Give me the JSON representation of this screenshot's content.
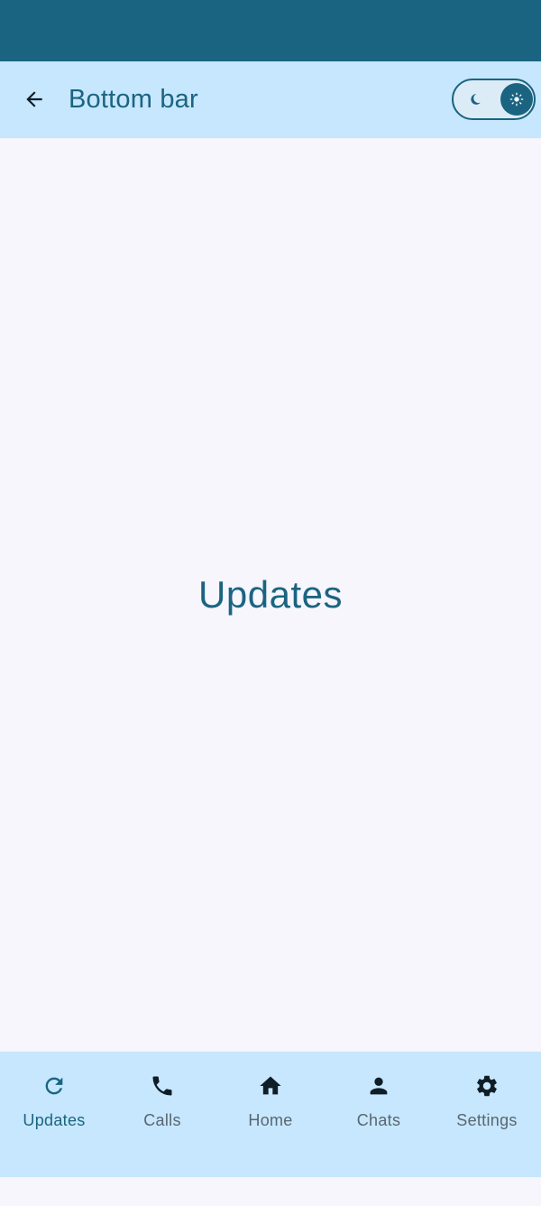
{
  "app_bar": {
    "title": "Bottom bar",
    "back_icon": "arrow-back-icon",
    "theme_toggle": {
      "state": "light",
      "off_icon": "moon-icon",
      "on_icon": "sun-icon"
    }
  },
  "content": {
    "title": "Updates"
  },
  "bottom_nav": {
    "items": [
      {
        "label": "Updates",
        "icon": "refresh-icon",
        "active": true
      },
      {
        "label": "Calls",
        "icon": "phone-icon",
        "active": false
      },
      {
        "label": "Home",
        "icon": "home-icon",
        "active": false
      },
      {
        "label": "Chats",
        "icon": "person-icon",
        "active": false
      },
      {
        "label": "Settings",
        "icon": "gear-icon",
        "active": false
      }
    ]
  },
  "colors": {
    "primary": "#1b6481",
    "surface": "#c6e7fd",
    "background": "#f6f6fc",
    "inactive": "#5a6670",
    "icon_dark": "#0f1d26"
  }
}
